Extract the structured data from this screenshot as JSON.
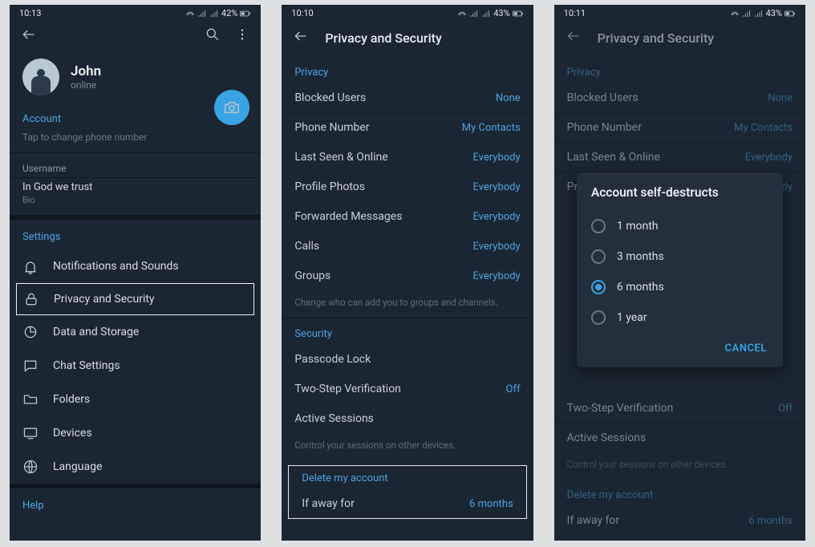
{
  "phone1": {
    "status_time": "10:13",
    "status_battery": "42%",
    "name": "John",
    "presence": "online",
    "account_header": "Account",
    "phone_hint": "Tap to change phone number",
    "username_label": "Username",
    "bio_text": "In God we trust",
    "bio_label": "Bio",
    "settings_header": "Settings",
    "items": [
      {
        "label": "Notifications and Sounds"
      },
      {
        "label": "Privacy and Security"
      },
      {
        "label": "Data and Storage"
      },
      {
        "label": "Chat Settings"
      },
      {
        "label": "Folders"
      },
      {
        "label": "Devices"
      },
      {
        "label": "Language"
      }
    ],
    "help_header": "Help"
  },
  "phone2": {
    "status_time": "10:10",
    "status_battery": "43%",
    "title": "Privacy and Security",
    "privacy_header": "Privacy",
    "rows": [
      {
        "label": "Blocked Users",
        "value": "None"
      },
      {
        "label": "Phone Number",
        "value": "My Contacts"
      },
      {
        "label": "Last Seen & Online",
        "value": "Everybody"
      },
      {
        "label": "Profile Photos",
        "value": "Everybody"
      },
      {
        "label": "Forwarded Messages",
        "value": "Everybody"
      },
      {
        "label": "Calls",
        "value": "Everybody"
      },
      {
        "label": "Groups",
        "value": "Everybody"
      }
    ],
    "groups_caption": "Change who can add you to groups and channels.",
    "security_header": "Security",
    "security_rows": [
      {
        "label": "Passcode Lock",
        "value": ""
      },
      {
        "label": "Two-Step Verification",
        "value": "Off"
      },
      {
        "label": "Active Sessions",
        "value": ""
      }
    ],
    "sessions_caption": "Control your sessions on other devices.",
    "delete_header": "Delete my account",
    "delete_label": "If away for",
    "delete_value": "6 months"
  },
  "phone3": {
    "status_time": "10:11",
    "status_battery": "43%",
    "title": "Privacy and Security",
    "privacy_header": "Privacy",
    "rows": [
      {
        "label": "Blocked Users",
        "value": "None"
      },
      {
        "label": "Phone Number",
        "value": "My Contacts"
      },
      {
        "label": "Last Seen & Online",
        "value": "Everybody"
      },
      {
        "label": "Profile Photos",
        "value": "Everybody"
      }
    ],
    "security_rows": [
      {
        "label": "Two-Step Verification",
        "value": "Off"
      },
      {
        "label": "Active Sessions",
        "value": ""
      }
    ],
    "sessions_caption": "Control your sessions on other devices.",
    "delete_header": "Delete my account",
    "delete_label": "If away for",
    "delete_value": "6 months",
    "modal": {
      "title": "Account self-destructs",
      "options": [
        {
          "label": "1 month",
          "checked": false
        },
        {
          "label": "3 months",
          "checked": false
        },
        {
          "label": "6 months",
          "checked": true
        },
        {
          "label": "1 year",
          "checked": false
        }
      ],
      "cancel": "CANCEL"
    }
  }
}
